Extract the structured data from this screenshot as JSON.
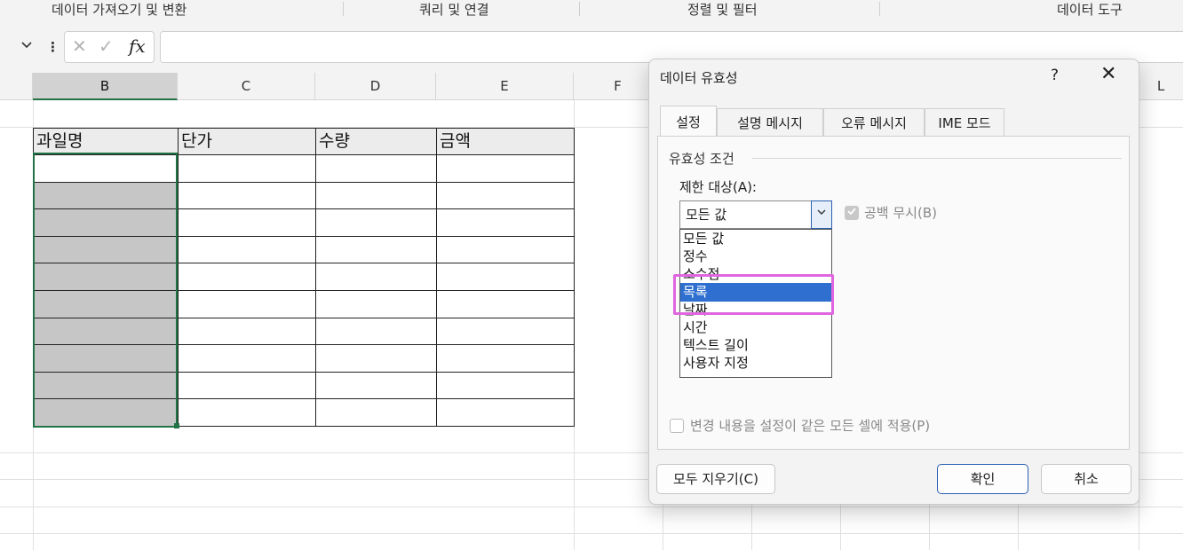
{
  "ribbon": {
    "groups": [
      "데이터 가져오기 및 변환",
      "쿼리 및 연결",
      "정렬 및 필터",
      "데이터 도구"
    ]
  },
  "formula_bar": {
    "fx_label": "fx"
  },
  "sheet": {
    "columns": [
      "B",
      "C",
      "D",
      "E",
      "F",
      "L"
    ],
    "table_headers": [
      "과일명",
      "단가",
      "수량",
      "금액"
    ]
  },
  "dialog": {
    "title": "데이터 유효성",
    "help": "?",
    "close": "✕",
    "tabs": [
      "설정",
      "설명 메시지",
      "오류 메시지",
      "IME 모드"
    ],
    "section_title": "유효성 조건",
    "allow_label": "제한 대상(A):",
    "allow_value": "모든 값",
    "ignore_blank": "공백 무시(B)",
    "options": [
      "모든 값",
      "정수",
      "소수점",
      "목록",
      "날짜",
      "시간",
      "텍스트 길이",
      "사용자 지정"
    ],
    "selected_option": "목록",
    "apply_all": "변경 내용을 설정이 같은 모든 셀에 적용(P)",
    "clear_all": "모두 지우기(C)",
    "ok": "확인",
    "cancel": "취소"
  }
}
